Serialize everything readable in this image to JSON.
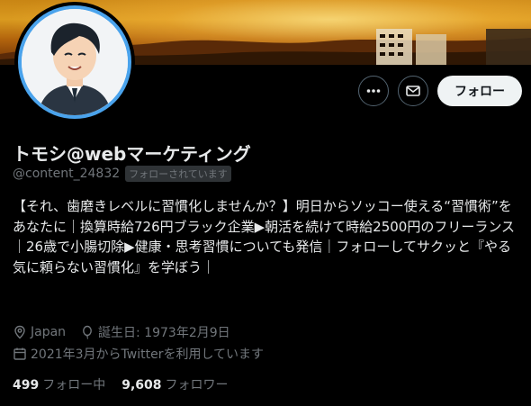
{
  "profile": {
    "display_name": "トモシ@webマーケティング",
    "handle": "@content_24832",
    "follows_you_badge": "フォローされています",
    "bio": "【それ、歯磨きレベルに習慣化しませんか？】明日からソッコー使える“習慣術”をあなたに｜換算時給726円ブラック企業▶朝活を続けて時給2500円のフリーランス｜26歳で小腸切除▶健康・思考習慣についても発信｜フォローしてサクッと『やる気に頼らない習慣化』を学ぼう｜",
    "location": "Japan",
    "birthday": "誕生日: 1973年2月9日",
    "joined": "2021年3月からTwitterを利用しています"
  },
  "stats": {
    "following_count": "499",
    "following_label": "フォロー中",
    "followers_count": "9,608",
    "followers_label": "フォロワー"
  },
  "actions": {
    "more_icon": "more-horizontal-icon",
    "message_icon": "envelope-icon",
    "follow_label": "フォロー"
  },
  "colors": {
    "background": "#000000",
    "primary_text": "#e7e9ea",
    "secondary_text": "#71767b",
    "follow_button_bg": "#eff3f4",
    "avatar_ring": "#4aa3ec"
  }
}
